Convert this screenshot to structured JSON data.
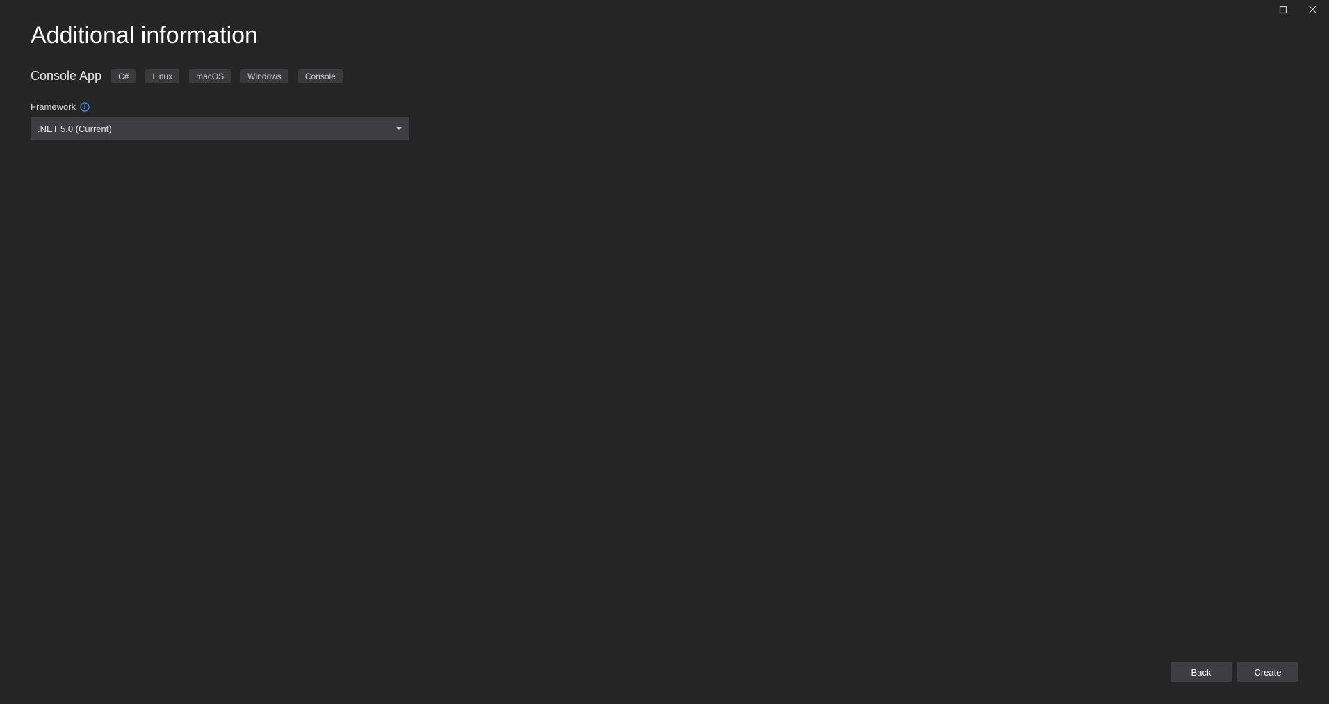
{
  "titlebar": {
    "maximize_title": "Maximize",
    "close_title": "Close"
  },
  "page": {
    "title": "Additional information"
  },
  "template": {
    "name": "Console App",
    "tags": [
      "C#",
      "Linux",
      "macOS",
      "Windows",
      "Console"
    ]
  },
  "framework": {
    "label": "Framework",
    "selected": ".NET 5.0 (Current)"
  },
  "footer": {
    "back_label": "Back",
    "create_label": "Create"
  }
}
